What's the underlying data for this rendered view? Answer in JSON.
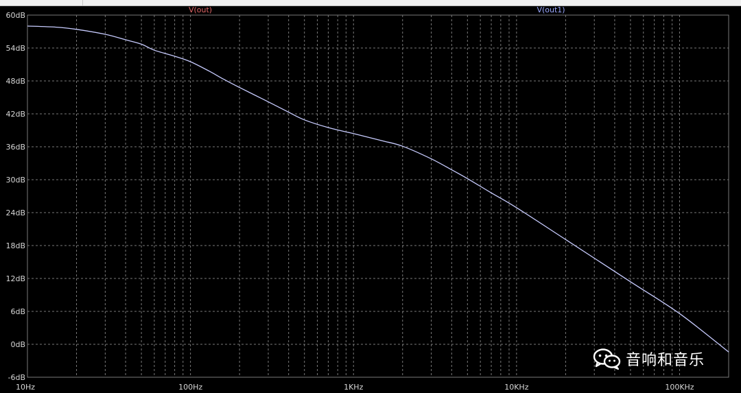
{
  "window": {
    "title": ""
  },
  "watermark": {
    "text": "音响和音乐",
    "icon": "wechat-icon"
  },
  "colors": {
    "background": "#000000",
    "grid": "#7a7a7a",
    "axis_text": "#d8d8d8",
    "trace_out": "#e06666",
    "trace_out1": "#9aa8ff",
    "trace_line": "#c8ccff"
  },
  "chart_data": {
    "type": "line",
    "title": "",
    "xlabel": "",
    "ylabel": "",
    "xscale": "log",
    "xlim": [
      10,
      200000
    ],
    "ylim": [
      -6,
      60
    ],
    "grid": true,
    "legend": [
      {
        "name": "V(out)",
        "color": "#e06666",
        "placement": "top-left-center"
      },
      {
        "name": "V(out1)",
        "color": "#9aa8ff",
        "placement": "top-right-center"
      }
    ],
    "x_ticks": [
      {
        "value": 10,
        "label": "10Hz"
      },
      {
        "value": 100,
        "label": "100Hz"
      },
      {
        "value": 1000,
        "label": "1KHz"
      },
      {
        "value": 10000,
        "label": "10KHz"
      },
      {
        "value": 100000,
        "label": "100KHz"
      }
    ],
    "y_ticks": [
      {
        "value": 60,
        "label": "60dB"
      },
      {
        "value": 54,
        "label": "54dB"
      },
      {
        "value": 48,
        "label": "48dB"
      },
      {
        "value": 42,
        "label": "42dB"
      },
      {
        "value": 36,
        "label": "36dB"
      },
      {
        "value": 30,
        "label": "30dB"
      },
      {
        "value": 24,
        "label": "24dB"
      },
      {
        "value": 18,
        "label": "18dB"
      },
      {
        "value": 12,
        "label": "12dB"
      },
      {
        "value": 6,
        "label": "6dB"
      },
      {
        "value": 0,
        "label": "0dB"
      },
      {
        "value": -6,
        "label": "-6dB"
      }
    ],
    "series": [
      {
        "name": "V(out1)",
        "x": [
          10,
          15,
          20,
          30,
          40,
          50,
          60,
          80,
          100,
          130,
          160,
          200,
          300,
          400,
          500,
          700,
          1000,
          1500,
          2000,
          3000,
          4000,
          5000,
          7000,
          10000,
          20000,
          50000,
          100000,
          200000
        ],
        "y": [
          58.0,
          57.8,
          57.4,
          56.5,
          55.5,
          54.7,
          53.6,
          52.5,
          51.5,
          49.8,
          48.3,
          46.8,
          44.2,
          42.3,
          40.9,
          39.5,
          38.4,
          37.1,
          36.1,
          33.8,
          31.8,
          30.2,
          27.6,
          24.9,
          19.1,
          11.4,
          5.6,
          -1.4
        ]
      }
    ]
  }
}
